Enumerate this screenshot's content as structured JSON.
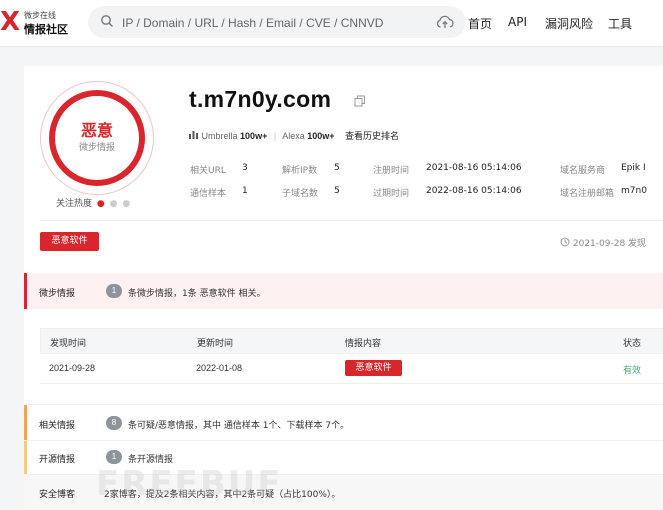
{
  "logo": {
    "mark": "X",
    "line1": "微步在线",
    "line2": "情报社区"
  },
  "search": {
    "placeholder": "IP / Domain / URL / Hash / Email / CVE / CNNVD"
  },
  "nav": {
    "home": "首页",
    "api": "API",
    "vuln": "漏洞风险",
    "tools": "工具"
  },
  "verdict": {
    "label": "恶意",
    "source": "微步情报",
    "heat_label": "关注热度",
    "heat_level": 1,
    "heat_max": 3
  },
  "domain": "t.m7n0y.com",
  "ranks": {
    "umbrella_label": "Umbrella",
    "umbrella_value": "100w+",
    "alexa_label": "Alexa",
    "alexa_value": "100w+",
    "history_link": "查看历史排名"
  },
  "info": {
    "related_url_label": "相关URL",
    "related_url_value": "3",
    "resolved_ip_label": "解析IP数",
    "resolved_ip_value": "5",
    "reg_time_label": "注册时间",
    "reg_time_value": "2021-08-16 05:14:06",
    "registrar_label": "域名服务商",
    "registrar_value": "Epik I",
    "comm_sample_label": "通信样本",
    "comm_sample_value": "1",
    "subdomain_label": "子域名数",
    "subdomain_value": "5",
    "exp_time_label": "过期时间",
    "exp_time_value": "2022-08-16 05:14:06",
    "reg_email_label": "域名注册邮箱",
    "reg_email_value": "m7n0"
  },
  "tag": "恶意软件",
  "discover": "2021-09-28 发现",
  "weibu": {
    "label": "微步情报",
    "count": "1",
    "desc": "条微步情报，1条 恶意软件 相关。"
  },
  "table": {
    "headers": [
      "发现时间",
      "更新时间",
      "情报内容",
      "状态"
    ],
    "rows": [
      {
        "found": "2021-09-28",
        "updated": "2022-01-08",
        "content": "恶意软件",
        "status": "有效"
      }
    ]
  },
  "related": {
    "label": "相关情报",
    "count": "8",
    "desc": "条可疑/恶意情报，其中 通信样本 1个、下载样本 7个。"
  },
  "opensource": {
    "label": "开源情报",
    "count": "1",
    "desc": "条开源情报"
  },
  "blog": {
    "label": "安全博客",
    "desc": "2家博客，提及2条相关内容，其中2条可疑（占比100%）。"
  },
  "watermark": "FREEBUF",
  "colors": {
    "accent": "#d9262c",
    "valid": "#3cb371",
    "related_bar": "#f0a35e",
    "opensource_bar": "#f5c98a"
  }
}
